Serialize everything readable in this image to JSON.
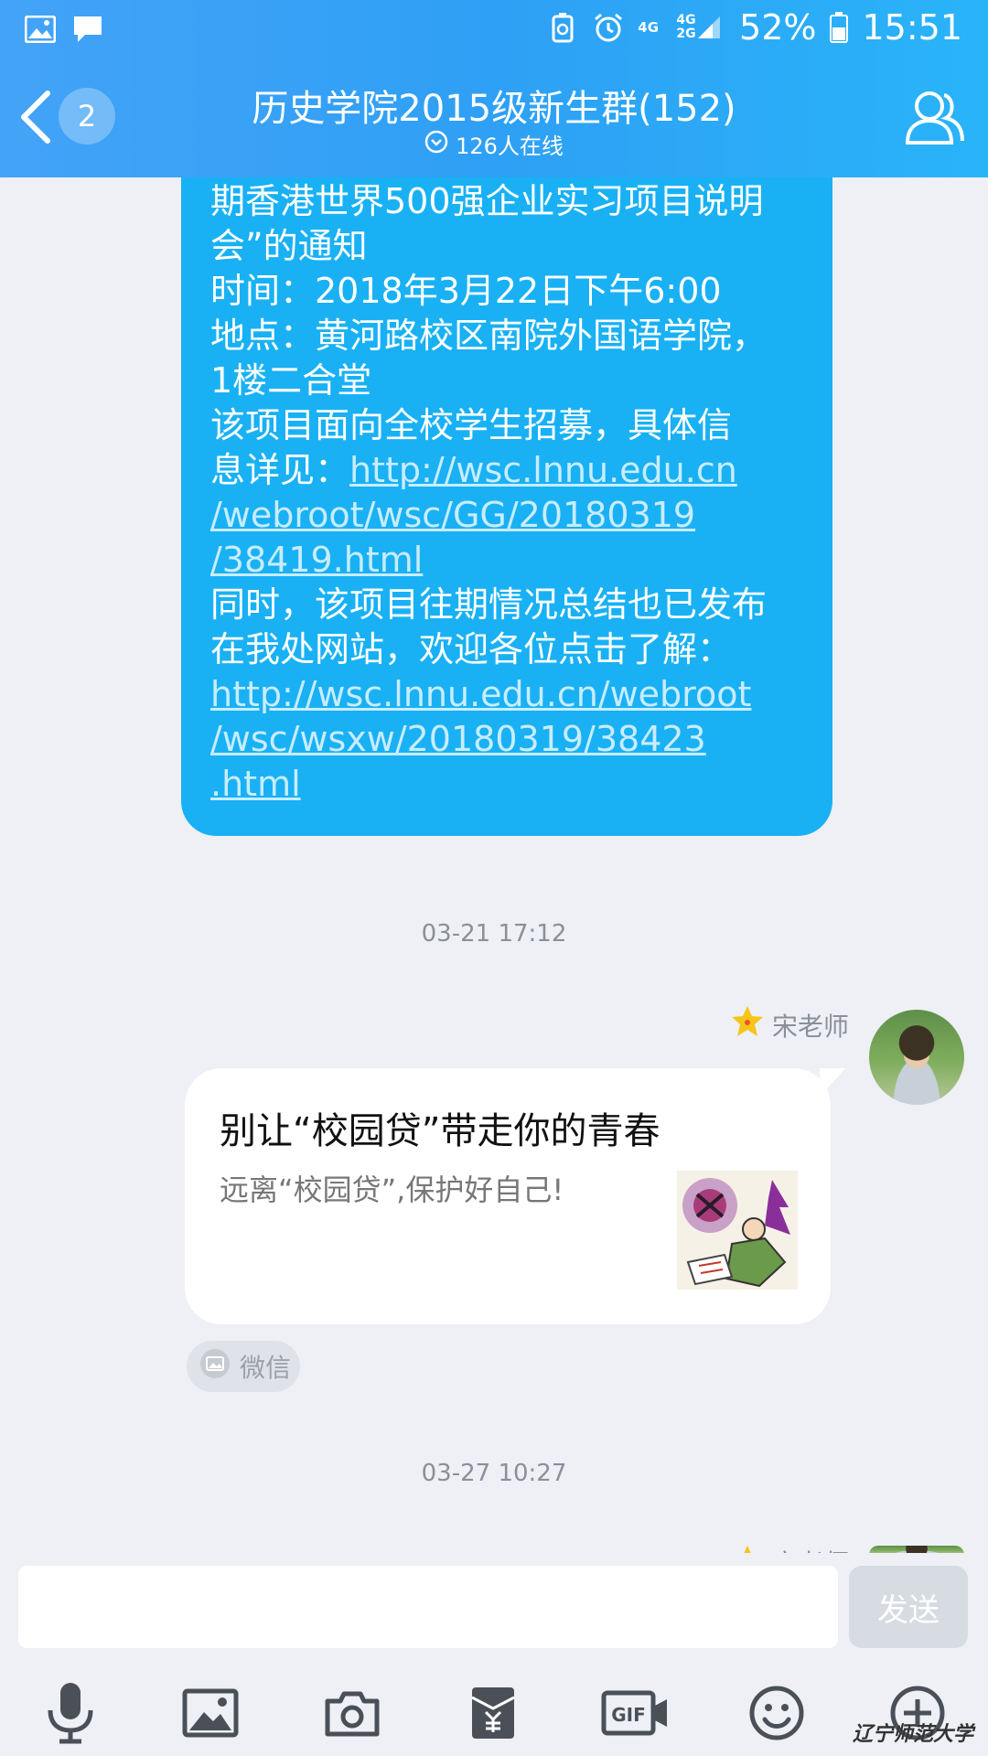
{
  "statusbar": {
    "network_1": "4G",
    "network_2": "4G\n2G",
    "battery": "52%",
    "time": "15:51"
  },
  "header": {
    "unread_badge": "2",
    "title": "历史学院2015级新生群(152)",
    "online_status": "126人在线"
  },
  "messages": {
    "notice_lines": [
      "期香港世界500强企业实习项目说明",
      "会”的通知",
      "时间：2018年3月22日下午6:00",
      "地点：黄河路校区南院外国语学院，",
      "1楼二合堂",
      "该项目面向全校学生招募，具体信",
      "息详见：",
      "http://wsc.lnnu.edu.cn",
      "/webroot/wsc/GG/20180319",
      "/38419.html",
      "同时，该项目往期情况总结也已发布",
      "在我处网站，欢迎各位点击了解：",
      "http://wsc.lnnu.edu.cn/webroot",
      "/wsc/wsxw/20180319/38423",
      ".html"
    ],
    "timestamp_1": "03-21 17:12",
    "sender_name": "宋老师",
    "card_title": "别让“校园贷”带走你的青春",
    "card_desc": "远离“校园贷”,保护好自己!",
    "card_source": "微信",
    "timestamp_2": "03-27 10:27",
    "partial_sender_name": "宋老师"
  },
  "input": {
    "placeholder": "",
    "send_label": "发送"
  },
  "toolbar": {
    "icons": [
      "microphone-icon",
      "image-icon",
      "camera-icon",
      "red-packet-icon",
      "gif-icon",
      "emoji-icon",
      "plus-icon"
    ]
  },
  "watermark": "辽宁师范大学",
  "colors": {
    "header": "#2ea0f5",
    "bubble": "#19b1f4",
    "background": "#eef0f5"
  }
}
